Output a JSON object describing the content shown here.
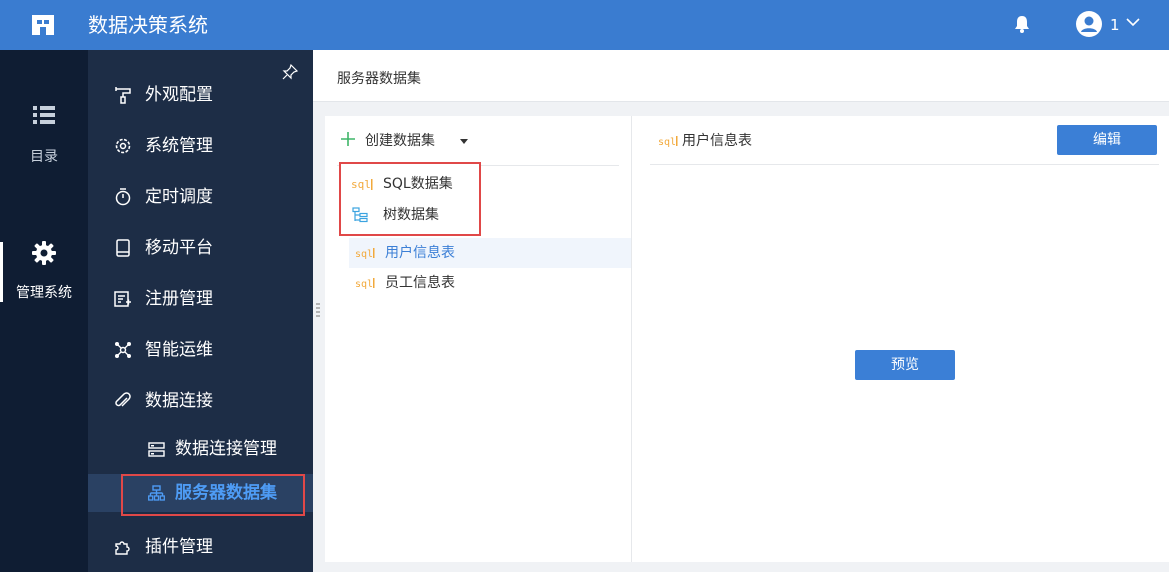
{
  "header": {
    "title": "数据决策系统",
    "logo_icon": "fr-logo-icon",
    "bell_icon": "bell-icon",
    "user_name": "1",
    "user_chevron_icon": "chevron-down-icon",
    "background": "#3a7cd0"
  },
  "rail": {
    "items": [
      {
        "label": "目录",
        "icon": "list-icon"
      },
      {
        "label": "管理系统",
        "icon": "gear-icon",
        "active": true
      }
    ],
    "background": "#0f1d33"
  },
  "sidebar": {
    "pin_icon": "pin-icon",
    "items": [
      {
        "label": "外观配置",
        "icon": "appearance-icon"
      },
      {
        "label": "系统管理",
        "icon": "settings-icon"
      },
      {
        "label": "定时调度",
        "icon": "timer-icon"
      },
      {
        "label": "移动平台",
        "icon": "mobile-icon"
      },
      {
        "label": "注册管理",
        "icon": "register-icon"
      },
      {
        "label": "智能运维",
        "icon": "network-icon"
      },
      {
        "label": "数据连接",
        "icon": "paperclip-icon"
      },
      {
        "label": "插件管理",
        "icon": "puzzle-icon"
      }
    ],
    "sub_items": [
      {
        "label": "数据连接管理",
        "icon": "server-icon"
      },
      {
        "label": "服务器数据集",
        "icon": "hierarchy-icon",
        "active": true
      }
    ],
    "background": "#1d2d46",
    "active_color": "#4e9cf5"
  },
  "main": {
    "breadcrumb": "服务器数据集",
    "create_button": "创建数据集",
    "create_menu": [
      {
        "label": "SQL数据集",
        "icon": "sql-icon"
      },
      {
        "label": "树数据集",
        "icon": "tree-icon"
      }
    ],
    "datasets": [
      {
        "label": "用户信息表",
        "icon": "sql-icon",
        "selected": true
      },
      {
        "label": "员工信息表",
        "icon": "sql-icon"
      }
    ],
    "detail": {
      "title": "用户信息表",
      "edit_button": "编辑",
      "preview_button": "预览"
    },
    "accent": "#3b7fd6",
    "highlight": "#e04848"
  }
}
